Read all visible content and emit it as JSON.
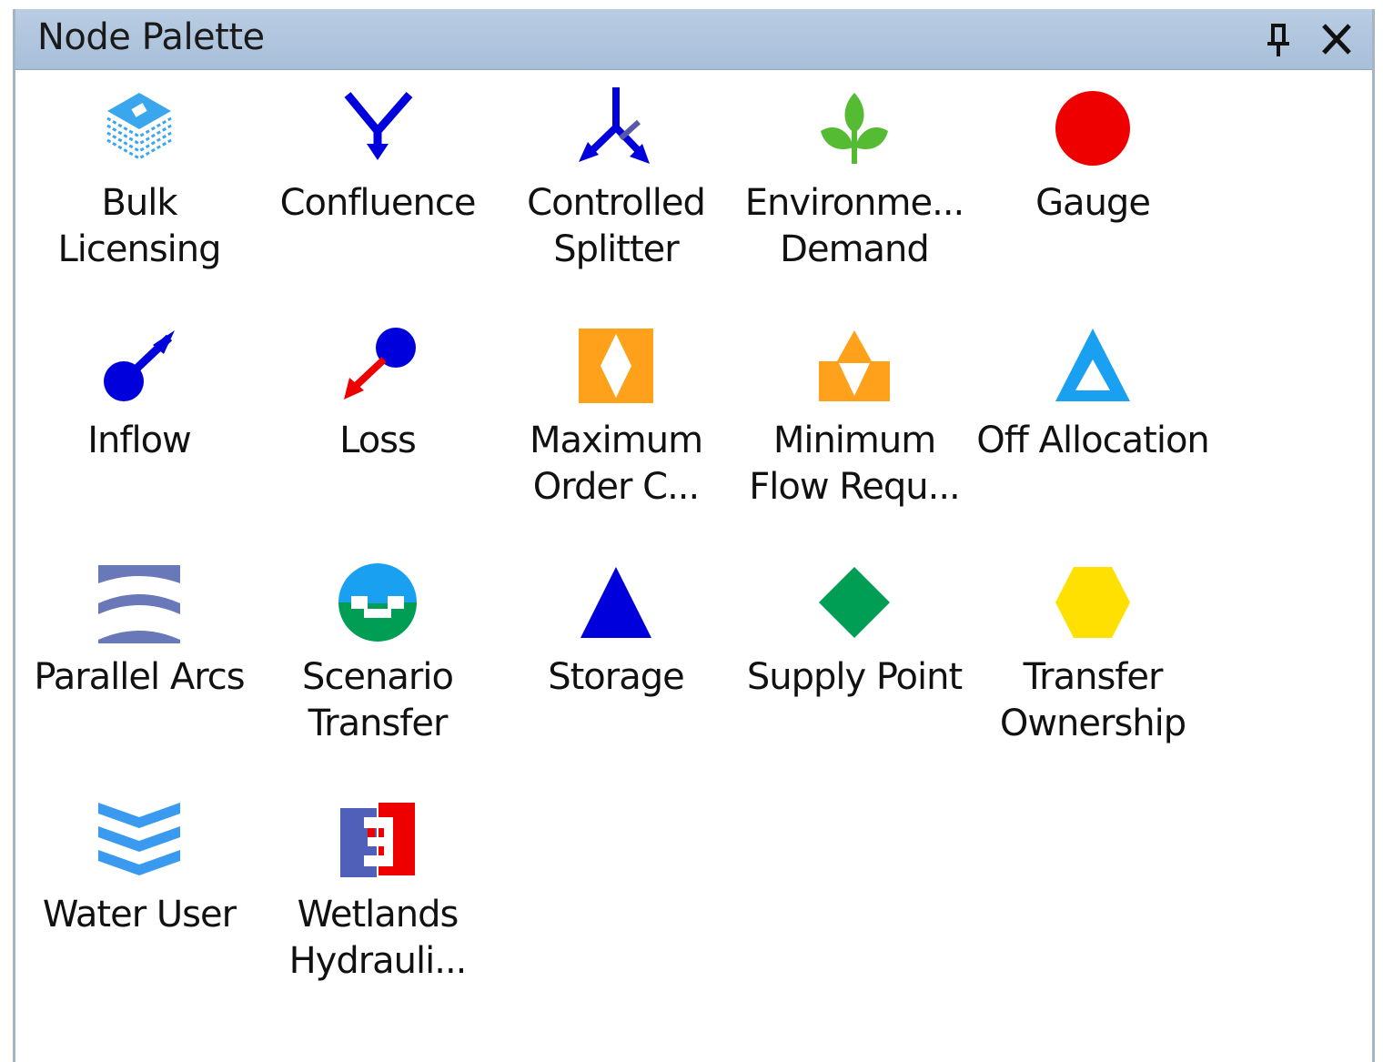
{
  "window": {
    "title": "Node Palette"
  },
  "titlebar_buttons": [
    {
      "name": "pin",
      "icon": "pin-icon"
    },
    {
      "name": "close",
      "icon": "close-icon"
    }
  ],
  "nodes": [
    {
      "label": "Bulk\nLicensing",
      "icon": "bulk-licensing-icon"
    },
    {
      "label": "Confluence",
      "icon": "confluence-icon"
    },
    {
      "label": "Controlled\nSplitter",
      "icon": "controlled-splitter-icon"
    },
    {
      "label": "Environme...\nDemand",
      "icon": "environmental-demand-icon"
    },
    {
      "label": "Gauge",
      "icon": "gauge-icon"
    },
    {
      "label": "Inflow",
      "icon": "inflow-icon"
    },
    {
      "label": "Loss",
      "icon": "loss-icon"
    },
    {
      "label": "Maximum\nOrder C...",
      "icon": "maximum-order-icon"
    },
    {
      "label": "Minimum\nFlow Requ...",
      "icon": "minimum-flow-icon"
    },
    {
      "label": "Off Allocation",
      "icon": "off-allocation-icon"
    },
    {
      "label": "Parallel Arcs",
      "icon": "parallel-arcs-icon"
    },
    {
      "label": "Scenario\nTransfer",
      "icon": "scenario-transfer-icon"
    },
    {
      "label": "Storage",
      "icon": "storage-icon"
    },
    {
      "label": "Supply Point",
      "icon": "supply-point-icon"
    },
    {
      "label": "Transfer\nOwnership",
      "icon": "transfer-ownership-icon"
    },
    {
      "label": "Water User",
      "icon": "water-user-icon"
    },
    {
      "label": "Wetlands\nHydrauli...",
      "icon": "wetlands-hydraulic-icon"
    }
  ],
  "colors": {
    "titlebar": "#b0c6de",
    "border": "#a6b4c4",
    "blue": "#0000dd",
    "red": "#ee0000",
    "orange": "#ffa11a",
    "green": "#009e55",
    "yellow": "#ffe000",
    "cyan": "#1aa0f0",
    "slate": "#6878b8",
    "leaf": "#55bb33"
  }
}
